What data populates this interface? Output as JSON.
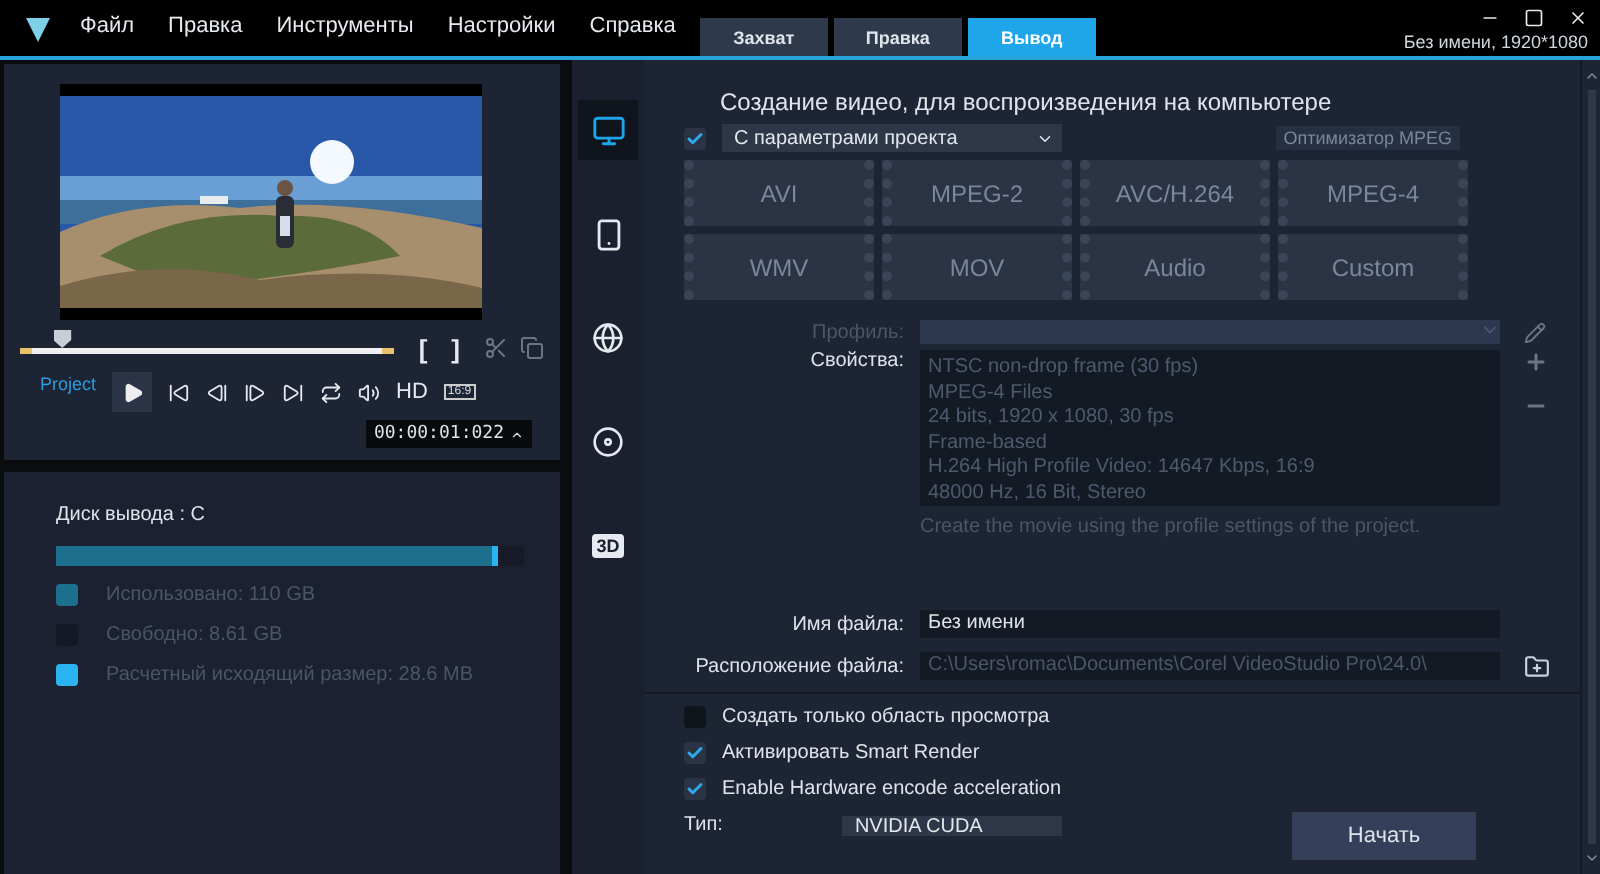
{
  "menu": [
    "Файл",
    "Правка",
    "Инструменты",
    "Настройки",
    "Справка"
  ],
  "tabs": [
    {
      "label": "Захват",
      "selected": false
    },
    {
      "label": "Правка",
      "selected": false
    },
    {
      "label": "Вывод",
      "selected": true
    }
  ],
  "project_info": "Без имени, 1920*1080",
  "preview": {
    "level": 0.11,
    "mode_label": "Project",
    "mark_in": "[",
    "mark_out": "]",
    "quality": "HD",
    "aspect": "16:9",
    "timecode": "00:00:01:022"
  },
  "disk": {
    "title": "Диск вывода : C",
    "level": 0.93,
    "legend": [
      {
        "label": "Использовано: 110 GB",
        "color": "#1d6f8e"
      },
      {
        "label": "Свободно: 8.61 GB",
        "color": "#141925"
      },
      {
        "label": "Расчетный исходящий размер: 28.6 MB",
        "color": "#2ab4f2"
      }
    ]
  },
  "side_nav": [
    {
      "kind": "computer",
      "selected": true
    },
    {
      "kind": "device",
      "selected": false
    },
    {
      "kind": "web",
      "selected": false
    },
    {
      "kind": "disc",
      "selected": false
    },
    {
      "kind": "threed",
      "label": "3D",
      "selected": false
    }
  ],
  "output": {
    "heading": "Создание видео, для воспроизведения на компьютере",
    "project_settings": {
      "checked": true,
      "value": "С параметрами проекта"
    },
    "mpeg_optimizer": {
      "label": "Оптимизатор MPEG",
      "disabled": true
    },
    "formats": [
      {
        "label": "AVI",
        "disabled": true
      },
      {
        "label": "MPEG-2",
        "disabled": true
      },
      {
        "label": "AVC/H.264",
        "disabled": true
      },
      {
        "label": "MPEG-4",
        "disabled": true
      },
      {
        "label": "WMV",
        "disabled": true
      },
      {
        "label": "MOV",
        "disabled": true
      },
      {
        "label": "Audio",
        "disabled": true
      },
      {
        "label": "Custom",
        "disabled": true
      }
    ],
    "profile": {
      "label": "Профиль:",
      "disabled": true
    },
    "properties": {
      "label": "Свойства:",
      "lines": [
        "NTSC non-drop frame (30 fps)",
        "MPEG-4 Files",
        "24 bits, 1920 x 1080, 30 fps",
        "Frame-based",
        "H.264 High Profile Video: 14647 Kbps, 16:9",
        "48000 Hz, 16 Bit, Stereo"
      ]
    },
    "hint": "Create the movie using the profile settings of the project.",
    "file_name": {
      "label": "Имя файла:",
      "value": "Без имени"
    },
    "file_location": {
      "label": "Расположение файла:",
      "value": "C:\\Users\\romac\\Documents\\Corel VideoStudio Pro\\24.0\\",
      "disabled": true
    },
    "options": [
      {
        "label": "Создать только область просмотра",
        "checked": false
      },
      {
        "label": "Активировать Smart Render",
        "checked": true
      },
      {
        "label": "Enable Hardware encode acceleration",
        "checked": true
      }
    ],
    "type": {
      "label": "Тип:",
      "value": "NVIDIA CUDA"
    },
    "start_button": "Начать"
  }
}
